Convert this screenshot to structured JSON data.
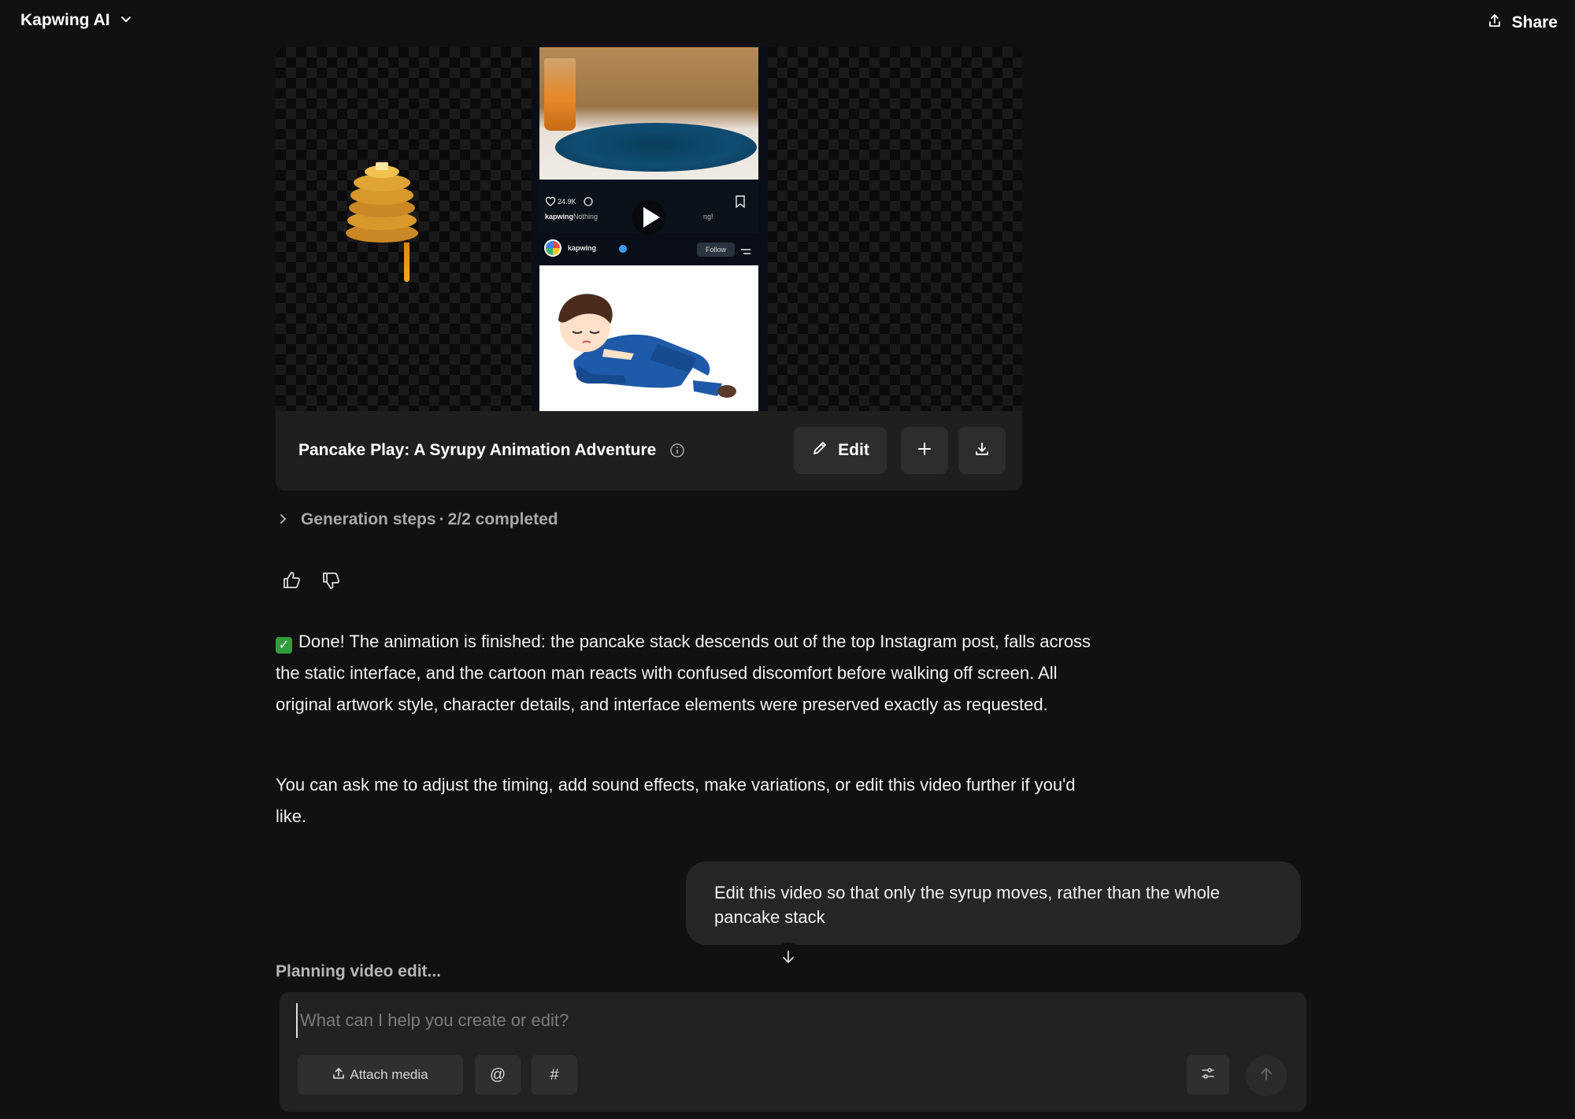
{
  "header": {
    "app_title": "Kapwing AI",
    "share_label": "Share"
  },
  "video": {
    "title": "Pancake Play: A Syrupy Animation Adventure",
    "edit_label": "Edit",
    "preview": {
      "likes": "24.9K",
      "username": "kapwing",
      "caption_fragment_left": "Nothing",
      "caption_fragment_right": "ng!",
      "account_name": "kapwing",
      "follow_label": "Follow"
    }
  },
  "generation_steps": {
    "label": "Generation steps",
    "separator": "·",
    "status": "2/2 completed"
  },
  "assistant_message": {
    "paragraph_1": "Done! The animation is finished: the pancake stack descends out of the top Instagram post, falls across the static interface, and the cartoon man reacts with confused discomfort before walking off screen. All original artwork style, character details, and interface elements were preserved exactly as requested.",
    "paragraph_2": "You can ask me to adjust the timing, add sound effects, make variations, or edit this video further if you'd like."
  },
  "user_message": {
    "text": "Edit this video so that only the syrup moves, rather than the whole pancake stack"
  },
  "status": {
    "planning": "Planning video edit..."
  },
  "composer": {
    "placeholder": "What can I help you create or edit?",
    "attach_label": "Attach media",
    "mention_label": "@",
    "hash_label": "#"
  },
  "colors": {
    "background": "#111111",
    "surface": "#1f1f1f",
    "button": "#2d2d2d",
    "check": "#2f9e3c"
  }
}
